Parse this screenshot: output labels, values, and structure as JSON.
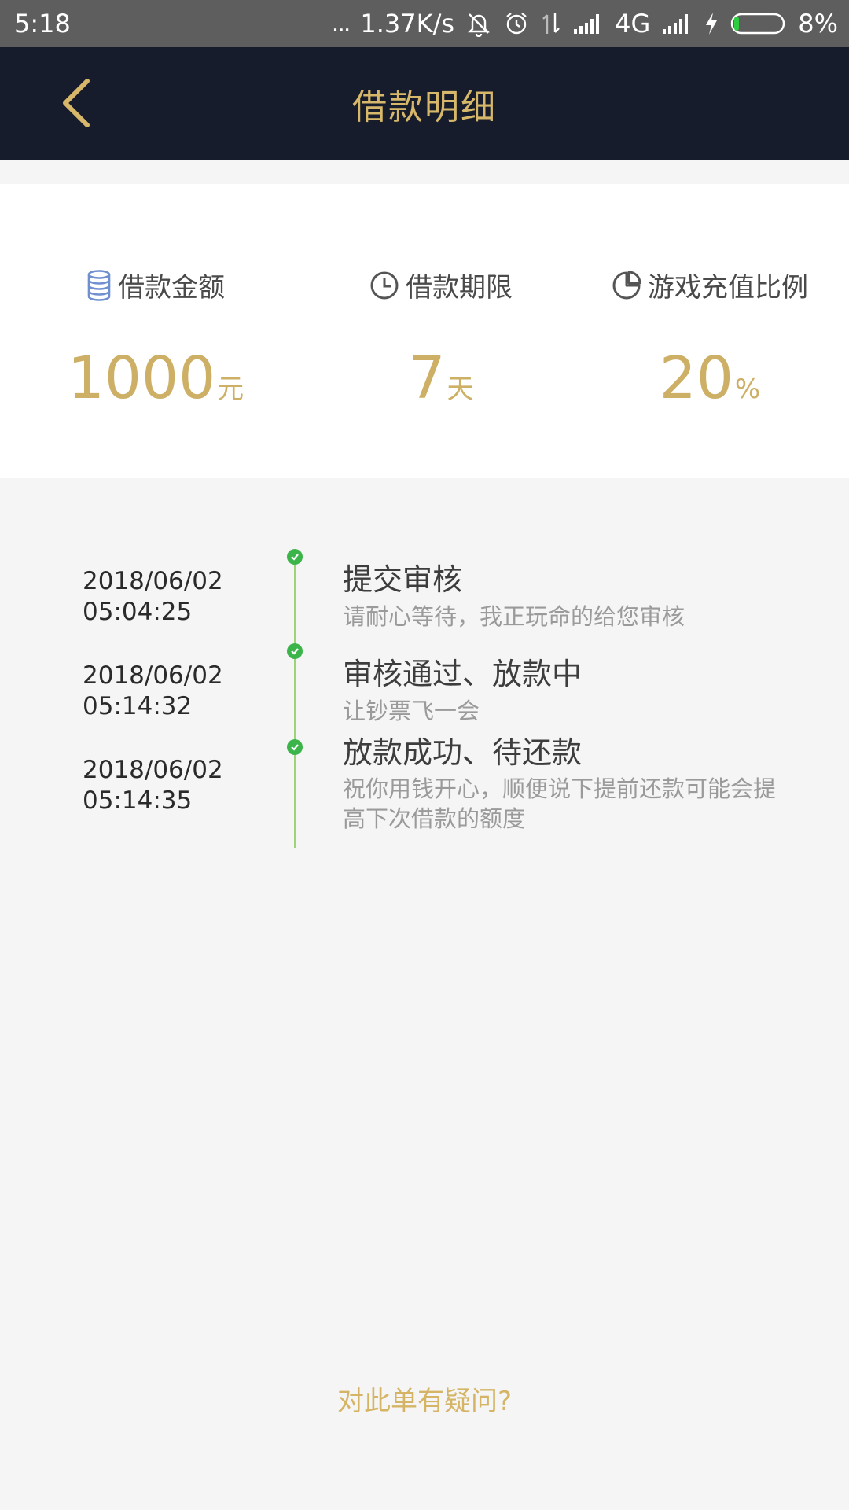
{
  "status_bar": {
    "time": "5:18",
    "dots": "...",
    "network_speed": "1.37K/s",
    "network_type": "4G",
    "battery_percent": "8%",
    "battery_level": 0.08
  },
  "header": {
    "title": "借款明细"
  },
  "summary": {
    "amount": {
      "label": "借款金额",
      "value": "1000",
      "unit": "元",
      "icon": "database-icon"
    },
    "term": {
      "label": "借款期限",
      "value": "7",
      "unit": "天",
      "icon": "clock-icon"
    },
    "ratio": {
      "label": "游戏充值比例",
      "value": "20",
      "unit": "%",
      "icon": "pie-chart-icon"
    }
  },
  "timeline": [
    {
      "date": "2018/06/02",
      "time": "05:04:25",
      "title": "提交审核",
      "desc": "请耐心等待，我正玩命的给您审核"
    },
    {
      "date": "2018/06/02",
      "time": "05:14:32",
      "title": "审核通过、放款中",
      "desc": "让钞票飞一会"
    },
    {
      "date": "2018/06/02",
      "time": "05:14:35",
      "title": "放款成功、待还款",
      "desc": "祝你用钱开心，顺便说下提前还款可能会提高下次借款的额度"
    }
  ],
  "footer": {
    "question_link": "对此单有疑问?"
  },
  "colors": {
    "header_bg": "#161c2b",
    "gold": "#d7b86a",
    "check_green": "#3bb54a",
    "timeline_line": "#9dd47a",
    "amount_icon": "#6f8fd0"
  }
}
